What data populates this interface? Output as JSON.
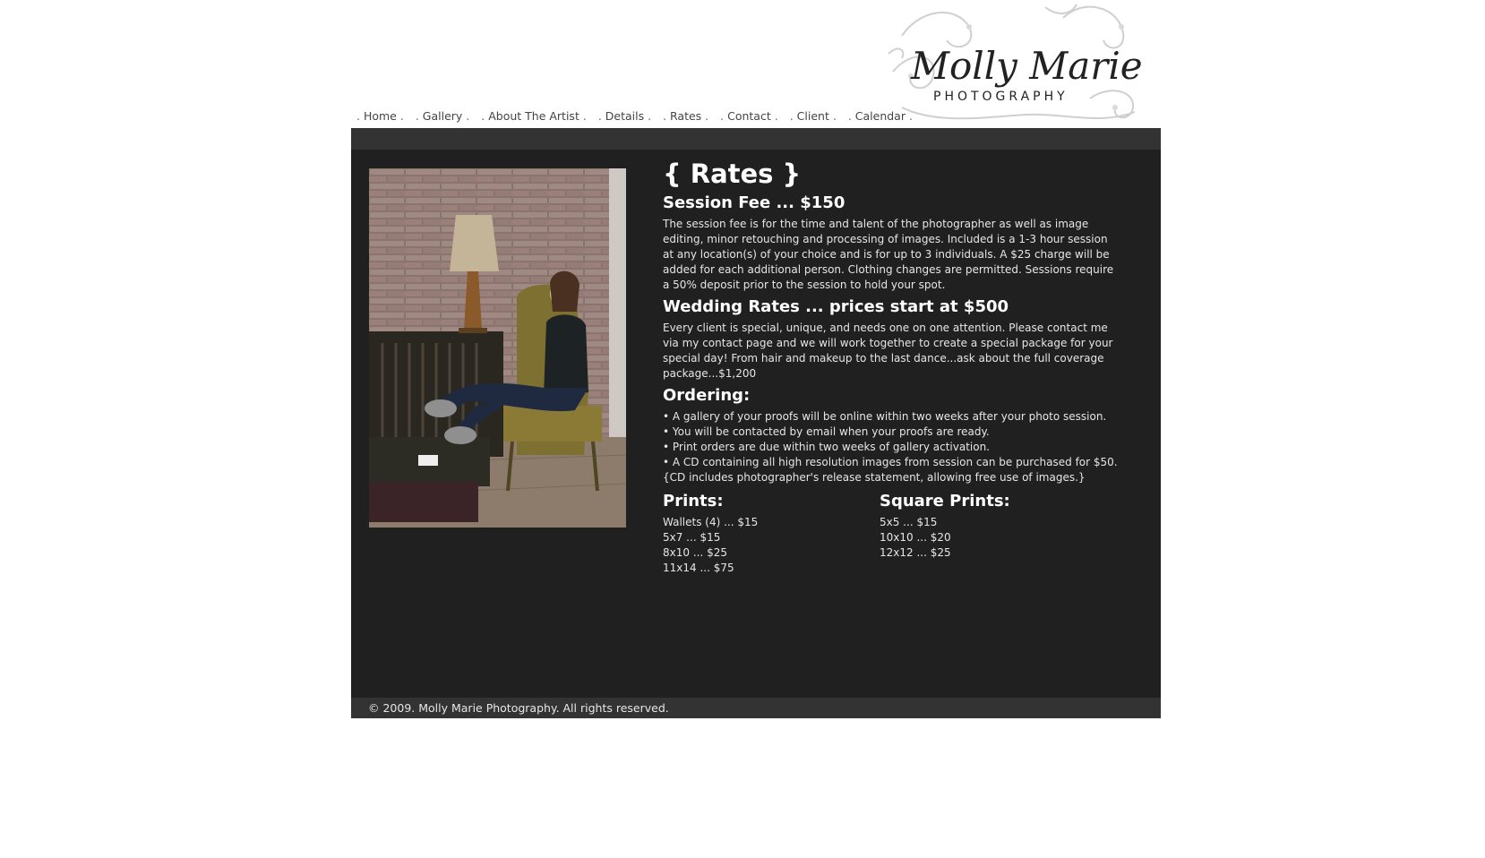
{
  "logo": {
    "script_text": "Molly Marie",
    "sub_text": "PHOTOGRAPHY"
  },
  "nav": {
    "items": [
      {
        "label": "Home"
      },
      {
        "label": "Gallery"
      },
      {
        "label": "About The Artist"
      },
      {
        "label": "Details"
      },
      {
        "label": "Rates"
      },
      {
        "label": "Contact"
      },
      {
        "label": "Client"
      },
      {
        "label": "Calendar"
      }
    ]
  },
  "main": {
    "title": "{ Rates }",
    "session_heading": "Session Fee ... $150",
    "session_text": "The session fee is for the time and talent of the photographer as well as image editing, minor retouching and processing of images. Included is a 1-3 hour session at any location(s) of your choice and is for up to 3 individuals. A $25 charge will be added for each additional person. Clothing changes are permitted. Sessions require a 50% deposit prior to the session to hold your spot.",
    "wedding_heading": "Wedding Rates ... prices start at $500",
    "wedding_text": "Every client is special, unique, and needs one on one attention. Please contact me via my contact page and we will work together to create a special package for your special day! From hair and makeup to the last dance...ask about the full coverage package...$1,200",
    "ordering_heading": "Ordering:",
    "ordering_items": [
      "• A gallery of your proofs will be online within two weeks after your photo session.",
      "• You will be contacted by email when your proofs are ready.",
      "• Print orders are due within two weeks of gallery activation.",
      "• A CD containing all high resolution images from session can be purchased for $50. {CD includes photographer's release statement, allowing free use of images.}"
    ],
    "prints_heading": "Prints:",
    "prints": [
      "Wallets (4) ... $15",
      "5x7 ... $15",
      "8x10 ... $25",
      "11x14 ... $75"
    ],
    "square_heading": "Square Prints:",
    "square_prints": [
      "5x5 ... $15",
      "10x10 ... $20",
      "12x12 ... $25"
    ]
  },
  "footer": {
    "copyright": "© 2009. Molly Marie Photography. All rights reserved."
  },
  "colors": {
    "panel": "#202020",
    "bar": "#333333",
    "text": "#e6e6e6"
  }
}
